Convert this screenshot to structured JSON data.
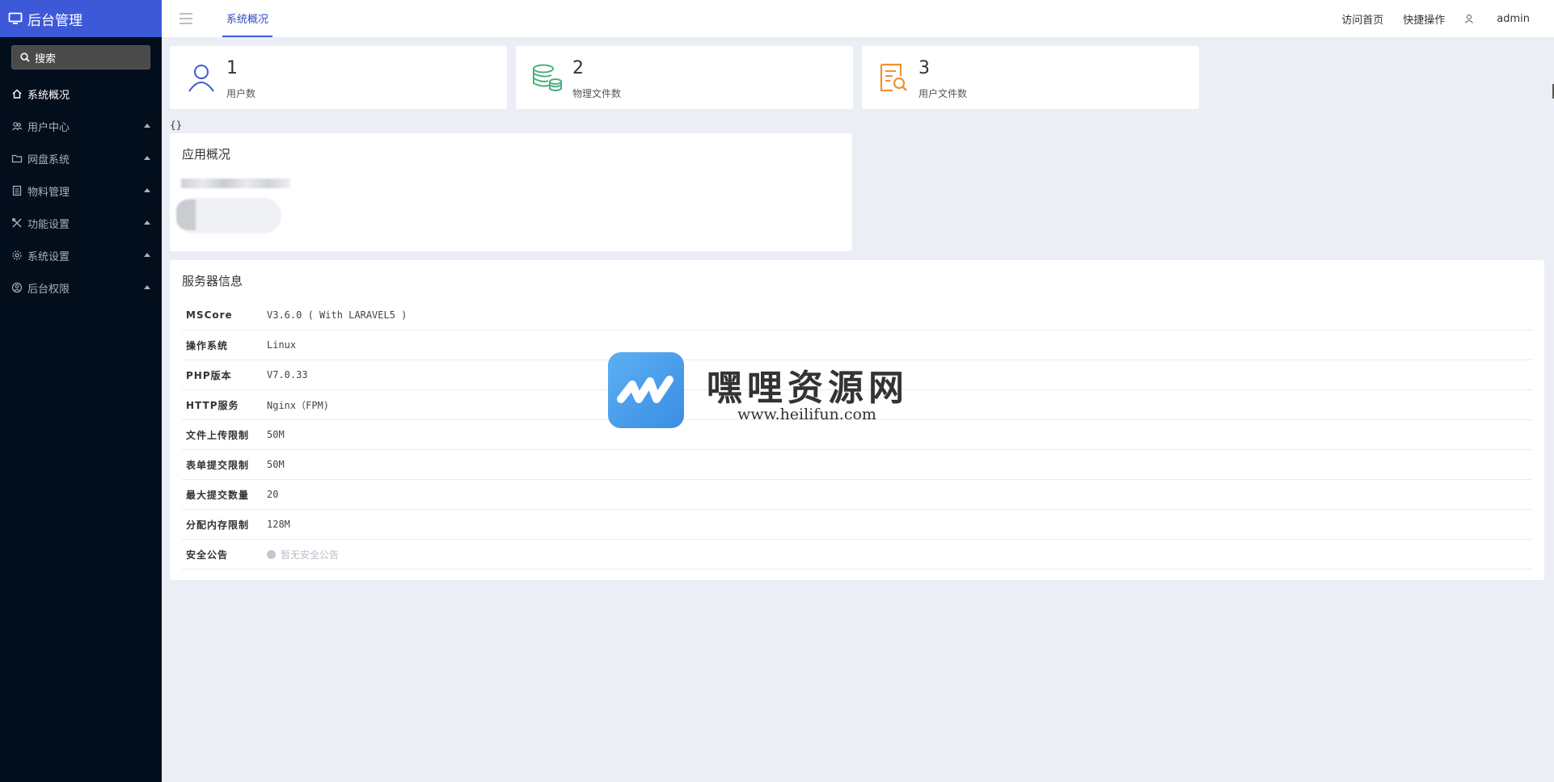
{
  "app": {
    "title": "后台管理"
  },
  "search": {
    "placeholder": "搜索"
  },
  "sidebar": {
    "items": [
      {
        "label": "系统概况",
        "icon": "home-icon",
        "active": true
      },
      {
        "label": "用户中心",
        "icon": "users-icon"
      },
      {
        "label": "网盘系统",
        "icon": "folder-icon"
      },
      {
        "label": "物料管理",
        "icon": "document-icon"
      },
      {
        "label": "功能设置",
        "icon": "tools-icon"
      },
      {
        "label": "系统设置",
        "icon": "gear-icon"
      },
      {
        "label": "后台权限",
        "icon": "user-circle-icon"
      }
    ]
  },
  "header": {
    "active_tab": "系统概况",
    "links": {
      "visit_home": "访问首页",
      "quick_actions": "快捷操作",
      "user": "admin"
    }
  },
  "stats": [
    {
      "value": "1",
      "label": "用户数",
      "icon": "user-icon",
      "color": "#3d59d8"
    },
    {
      "value": "2",
      "label": "物理文件数",
      "icon": "database-icon",
      "color": "#4caf7d"
    },
    {
      "value": "3",
      "label": "用户文件数",
      "icon": "file-search-icon",
      "color": "#f0922f"
    }
  ],
  "debug_text": "{}",
  "app_overview": {
    "title": "应用概况"
  },
  "server_info": {
    "title": "服务器信息",
    "rows": [
      {
        "key": "MSCore",
        "value": "V3.6.0 ( With LARAVEL5 )"
      },
      {
        "key": "操作系统",
        "value": "Linux"
      },
      {
        "key": "PHP版本",
        "value": "V7.0.33"
      },
      {
        "key": "HTTP服务",
        "value": "Nginx（FPM)"
      },
      {
        "key": "文件上传限制",
        "value": "50M"
      },
      {
        "key": "表单提交限制",
        "value": "50M"
      },
      {
        "key": "最大提交数量",
        "value": "20"
      },
      {
        "key": "分配内存限制",
        "value": "128M"
      },
      {
        "key": "安全公告",
        "value": "暂无安全公告"
      }
    ]
  },
  "watermark": {
    "title": "嘿哩资源网",
    "url": "www.heilifun.com"
  },
  "colors": {
    "sidebar_bg": "#030e1d",
    "brand_bg": "#3d59d8",
    "page_bg": "#ebeef4"
  }
}
